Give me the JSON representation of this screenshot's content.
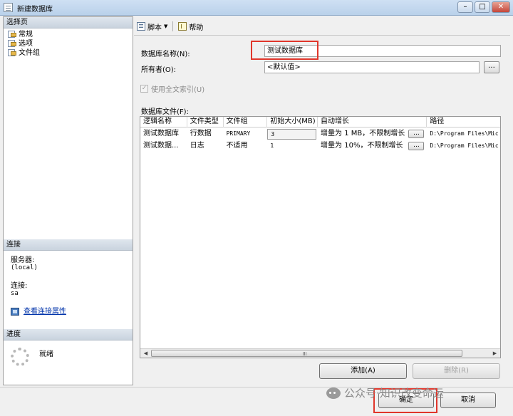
{
  "window": {
    "title": "新建数据库",
    "controls": {
      "minimize": "–",
      "maximize": "□",
      "close": "✕"
    }
  },
  "left_pane": {
    "pages_header": "选择页",
    "pages": [
      {
        "label": "常规"
      },
      {
        "label": "选项"
      },
      {
        "label": "文件组"
      }
    ],
    "connection": {
      "header": "连接",
      "server_label": "服务器:",
      "server_value": "(local)",
      "conn_label": "连接:",
      "conn_value": "sa",
      "view_props_link": "查看连接属性"
    },
    "progress": {
      "header": "进度",
      "status": "就绪"
    }
  },
  "toolbar": {
    "script_label": "脚本",
    "help_label": "帮助"
  },
  "form": {
    "db_name_label": "数据库名称(N):",
    "db_name_value": "测试数据库",
    "owner_label": "所有者(O):",
    "owner_value": "<默认值>",
    "browse_label": "...",
    "fulltext_label": "使用全文索引(U)",
    "fulltext_checked": true,
    "db_files_label": "数据库文件(F):"
  },
  "grid": {
    "columns": [
      "逻辑名称",
      "文件类型",
      "文件组",
      "初始大小(MB)",
      "自动增长",
      "路径"
    ],
    "rows": [
      {
        "name": "测试数据库",
        "type": "行数据",
        "filegroup": "PRIMARY",
        "size": "3",
        "growth": "增量为 1 MB，不限制增长",
        "path": "D:\\Program Files\\Mic"
      },
      {
        "name": "测试数据...",
        "type": "日志",
        "filegroup": "不适用",
        "size": "1",
        "growth": "增量为 10%，不限制增长",
        "path": "D:\\Program Files\\Mic"
      }
    ],
    "cell_button_label": "...",
    "scroll_left": "◀",
    "scroll_right": "▶"
  },
  "buttons": {
    "add": "添加(A)",
    "remove": "删除(R)",
    "ok": "确定",
    "cancel": "取消"
  },
  "watermark": "公众号·知识改变命运"
}
